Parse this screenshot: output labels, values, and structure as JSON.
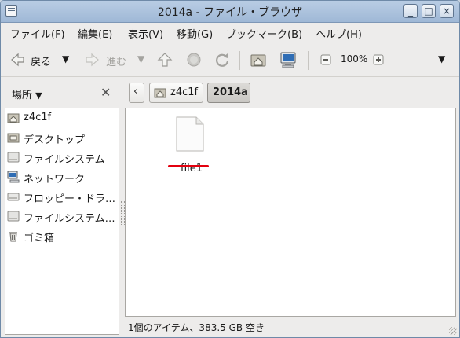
{
  "window": {
    "title": "2014a - ファイル・ブラウザ"
  },
  "menubar": {
    "items": [
      {
        "label": "ファイル(F)"
      },
      {
        "label": "編集(E)"
      },
      {
        "label": "表示(V)"
      },
      {
        "label": "移動(G)"
      },
      {
        "label": "ブックマーク(B)"
      },
      {
        "label": "ヘルプ(H)"
      }
    ]
  },
  "toolbar": {
    "back_label": "戻る",
    "forward_label": "進む",
    "zoom_level": "100%"
  },
  "sidebar": {
    "header_label": "場所",
    "items": [
      {
        "label": "z4c1f",
        "icon": "home-folder-icon"
      },
      {
        "label": "デスクトップ",
        "icon": "desktop-folder-icon"
      },
      {
        "label": "ファイルシステム",
        "icon": "drive-icon"
      },
      {
        "label": "ネットワーク",
        "icon": "network-icon"
      },
      {
        "label": "フロッピー・ドラ…",
        "icon": "floppy-icon"
      },
      {
        "label": "ファイルシステム…",
        "icon": "drive-icon"
      },
      {
        "label": "ゴミ箱",
        "icon": "trash-icon"
      }
    ]
  },
  "pathbar": {
    "crumbs": [
      {
        "label": "z4c1f"
      },
      {
        "label": "2014a"
      }
    ]
  },
  "files": [
    {
      "name": "file1"
    }
  ],
  "status": {
    "text": "1個のアイテム、383.5 GB 空き"
  },
  "colors": {
    "highlight": "#e3000f",
    "titlebar": "#a9bfdb"
  }
}
